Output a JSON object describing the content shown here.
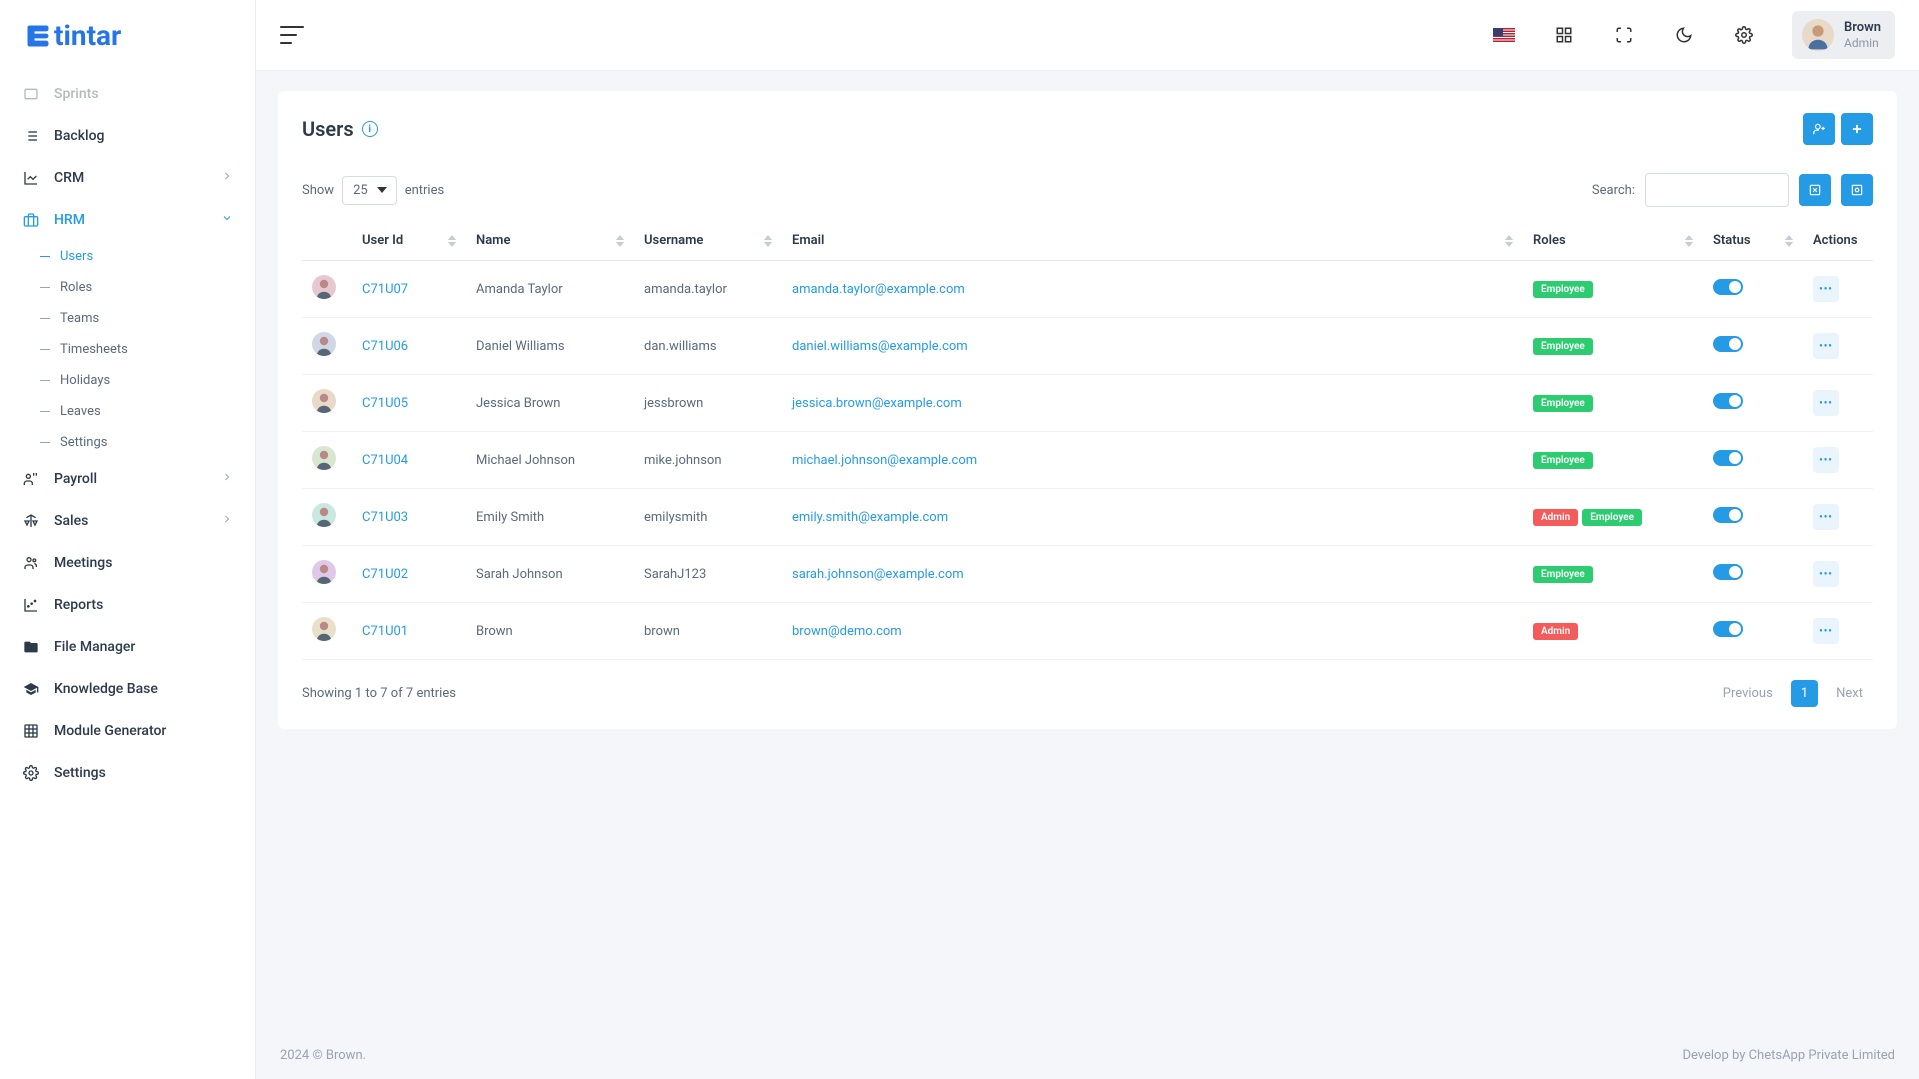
{
  "brand": "tintar",
  "topbar": {
    "user_name": "Brown",
    "user_role": "Admin"
  },
  "sidebar": {
    "sprints": "Sprints",
    "backlog": "Backlog",
    "crm": "CRM",
    "hrm": "HRM",
    "hrm_sub": {
      "users": "Users",
      "roles": "Roles",
      "teams": "Teams",
      "timesheets": "Timesheets",
      "holidays": "Holidays",
      "leaves": "Leaves",
      "settings": "Settings"
    },
    "payroll": "Payroll",
    "sales": "Sales",
    "meetings": "Meetings",
    "reports": "Reports",
    "file_manager": "File Manager",
    "knowledge_base": "Knowledge Base",
    "module_generator": "Module Generator",
    "settings": "Settings"
  },
  "page": {
    "title": "Users",
    "show_label": "Show",
    "entries_label": "entries",
    "page_size": "25",
    "search_label": "Search:",
    "columns": {
      "user_id": "User Id",
      "name": "Name",
      "username": "Username",
      "email": "Email",
      "roles": "Roles",
      "status": "Status",
      "actions": "Actions"
    },
    "rows": [
      {
        "id": "C71U07",
        "name": "Amanda Taylor",
        "username": "amanda.taylor",
        "email": "amanda.taylor@example.com",
        "roles": [
          "Employee"
        ]
      },
      {
        "id": "C71U06",
        "name": "Daniel Williams",
        "username": "dan.williams",
        "email": "daniel.williams@example.com",
        "roles": [
          "Employee"
        ]
      },
      {
        "id": "C71U05",
        "name": "Jessica Brown",
        "username": "jessbrown",
        "email": "jessica.brown@example.com",
        "roles": [
          "Employee"
        ]
      },
      {
        "id": "C71U04",
        "name": "Michael Johnson",
        "username": "mike.johnson",
        "email": "michael.johnson@example.com",
        "roles": [
          "Employee"
        ]
      },
      {
        "id": "C71U03",
        "name": "Emily Smith",
        "username": "emilysmith",
        "email": "emily.smith@example.com",
        "roles": [
          "Admin",
          "Employee"
        ]
      },
      {
        "id": "C71U02",
        "name": "Sarah Johnson",
        "username": "SarahJ123",
        "email": "sarah.johnson@example.com",
        "roles": [
          "Employee"
        ]
      },
      {
        "id": "C71U01",
        "name": "Brown",
        "username": "brown",
        "email": "brown@demo.com",
        "roles": [
          "Admin"
        ]
      }
    ],
    "info": "Showing 1 to 7 of 7 entries",
    "pagination": {
      "prev": "Previous",
      "current": "1",
      "next": "Next"
    }
  },
  "footer": {
    "left": "2024 © Brown.",
    "right": "Develop by ChetsApp Private Limited"
  }
}
